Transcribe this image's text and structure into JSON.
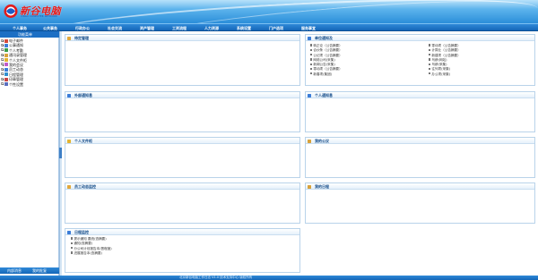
{
  "app": {
    "logo_text": "新谷电脑",
    "logo_sub": "XINGU COMPUTER NETWORK"
  },
  "menu": [
    "个人事务",
    "公共事务",
    "行政办公",
    "社会交流",
    "资产管理",
    "工资流程",
    "人力资源",
    "系统设置",
    "门户选项",
    "服务事宜"
  ],
  "sidebar": {
    "header": "功能菜单",
    "items": [
      {
        "label": "电子邮件",
        "icon": "mail-icon",
        "color": "#d34a3a"
      },
      {
        "label": "公事通知",
        "icon": "notice-icon",
        "color": "#3b7dd8"
      },
      {
        "label": "个人考勤",
        "icon": "calendar-icon",
        "color": "#3a9d4a"
      },
      {
        "label": "通讯录管理",
        "icon": "contacts-icon",
        "color": "#d8a23b"
      },
      {
        "label": "个人文件柜",
        "icon": "folder-icon",
        "color": "#e3b330"
      },
      {
        "label": "我的会议",
        "icon": "meeting-icon",
        "color": "#c05ac8"
      },
      {
        "label": "员工动态",
        "icon": "people-icon",
        "color": "#3b7dd8"
      },
      {
        "label": "日程管理",
        "icon": "schedule-icon",
        "color": "#2e8fcf"
      },
      {
        "label": "印章管理",
        "icon": "stamp-icon",
        "color": "#c94444"
      },
      {
        "label": "个性设置",
        "icon": "settings-icon",
        "color": "#5a6fbf"
      }
    ],
    "footer_tabs": [
      "内部消息",
      "我的批复"
    ]
  },
  "panels": {
    "affairs": {
      "title": "待定管理",
      "icon_color": "#e2a83a"
    },
    "dept_notice": {
      "title": "单位通知及",
      "left": [
        "转正论（公告摘要）",
        "合伙条（公告摘要）",
        "公记项（公告摘要）",
        "网络公司(采集)",
        "新闻公告(采集)",
        "零动项（公告摘要）",
        "新春项(集团)"
      ],
      "right": [
        "零动项（公告摘要）",
        "计算业（公告摘要）",
        "新建项（公告摘要）",
        "乌龄(网站)",
        "乌龄(采集)",
        "往列项(采集)",
        "办公项(采集)"
      ]
    },
    "ext_mail": {
      "title": "外部通知息",
      "icon_color": "#3b7dd8"
    },
    "personal_mail": {
      "title": "个人通知息",
      "icon_color": "#3b7dd8"
    },
    "personal_files": {
      "title": "个人文件柜",
      "icon_color": "#e3b330"
    },
    "my_notice": {
      "title": "我的公议",
      "icon_color": "#d8a23b"
    },
    "staff_monitor": {
      "title": "员工动态监控",
      "icon_color": "#e2a83a"
    },
    "my_schedule": {
      "title": "我的日程",
      "icon_color": "#d8a23b"
    },
    "schedule_monitor": {
      "title": "日程监控",
      "items": [
        "提示通知 要统(查摘要)",
        "通知(查摘要)",
        "分公司计划报告本(督程度)",
        "进展报告本(查摘要)"
      ]
    }
  },
  "status": {
    "text": "北京新谷电脑工作日志 V1.0 技术支持中心 版权所有"
  }
}
